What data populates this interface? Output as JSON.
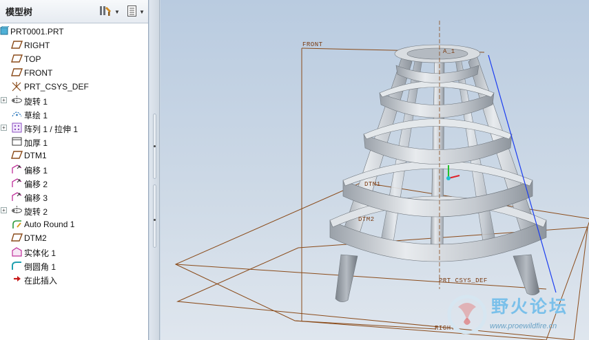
{
  "panel": {
    "title": "模型树",
    "settings_icon": "tree-settings-icon",
    "columns_icon": "tree-columns-icon"
  },
  "tree": {
    "items": [
      {
        "label": "PRT0001.PRT",
        "icon": "part-icon",
        "expandable": false,
        "root": true
      },
      {
        "label": "RIGHT",
        "icon": "datum-plane-icon",
        "expandable": false
      },
      {
        "label": "TOP",
        "icon": "datum-plane-icon",
        "expandable": false
      },
      {
        "label": "FRONT",
        "icon": "datum-plane-icon",
        "expandable": false
      },
      {
        "label": "PRT_CSYS_DEF",
        "icon": "csys-icon",
        "expandable": false
      },
      {
        "label": "旋转 1",
        "icon": "revolve-icon",
        "expandable": true
      },
      {
        "label": "草绘 1",
        "icon": "sketch-icon",
        "expandable": false
      },
      {
        "label": "阵列 1 / 拉伸 1",
        "icon": "pattern-icon",
        "expandable": true
      },
      {
        "label": "加厚 1",
        "icon": "thicken-icon",
        "expandable": false
      },
      {
        "label": "DTM1",
        "icon": "datum-plane-icon",
        "expandable": false
      },
      {
        "label": "偏移 1",
        "icon": "offset-icon",
        "expandable": false
      },
      {
        "label": "偏移 2",
        "icon": "offset-icon",
        "expandable": false
      },
      {
        "label": "偏移 3",
        "icon": "offset-icon",
        "expandable": false
      },
      {
        "label": "旋转 2",
        "icon": "revolve-icon",
        "expandable": true
      },
      {
        "label": "Auto Round 1",
        "icon": "auto-round-icon",
        "expandable": false
      },
      {
        "label": "DTM2",
        "icon": "datum-plane-icon",
        "expandable": false
      },
      {
        "label": "实体化 1",
        "icon": "solidify-icon",
        "expandable": false
      },
      {
        "label": "倒圆角 1",
        "icon": "round-icon",
        "expandable": false
      },
      {
        "label": "在此插入",
        "icon": "insert-here-arrow-icon",
        "expandable": false
      }
    ]
  },
  "viewport": {
    "labels": {
      "front": "FRONT",
      "axis": "A_1",
      "dtm1": "DTM1",
      "dtm2": "DTM2",
      "csys": "PRT_CSYS_DEF",
      "right": "RIGHT"
    }
  },
  "watermark": {
    "title": "野火论坛",
    "url": "www.proewildfire.cn"
  },
  "colors": {
    "datum_plane": "#8a4a18",
    "model_surface": "#c8cdd3",
    "edge": "#1a3cf0",
    "axis_y": "#22c02a",
    "axis_x": "#e0202a",
    "axis_z": "#20c0d0",
    "watermark": "#7ac0ea"
  }
}
